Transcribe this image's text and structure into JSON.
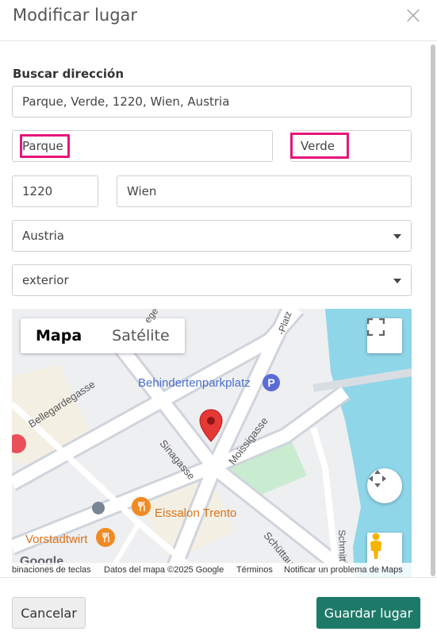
{
  "modal": {
    "title": "Modificar lugar",
    "close_symbol": "×",
    "close_icon": "close-icon"
  },
  "form": {
    "search_label": "Buscar dirección",
    "search_value": "Parque, Verde, 1220, Wien, Austria",
    "street_value": "Parque",
    "number_value": "Verde",
    "postal_value": "1220",
    "city_value": "Wien",
    "country_value": "Austria",
    "type_value": "exterior",
    "highlight_color": "#e6157a"
  },
  "map": {
    "type_map": "Mapa",
    "type_satellite": "Satélite",
    "labels": {
      "parking": "Behindertenparkplatz",
      "parking_badge": "P",
      "street_sinagasse": "Sinagasse",
      "street_moissigasse": "Moissigasse",
      "street_bellegarde": "Bellegardegasse",
      "street_schuttau": "Schüttau",
      "street_schmitt": "Schmitt",
      "street_platz": "-Platz",
      "street_top": "ege",
      "poi_eissalon": "Eissalon Trento",
      "poi_vorstadtwirt": "Vorstadtwirt",
      "google_logo": "Google"
    },
    "attribution": {
      "shortcuts": "binaciones de teclas",
      "data": "Datos del mapa ©2025 Google",
      "terms": "Términos",
      "report": "Notificar un problema de Maps"
    },
    "colors": {
      "water": "#8fd6e9",
      "park": "#c9ecd0",
      "road": "#ffffff",
      "marker": "#e53935",
      "parking_badge": "#5b6bd6",
      "poi": "#f08a24",
      "label": "#4a6ed0"
    },
    "icons": [
      "fullscreen-icon",
      "compass-icon",
      "pegman-icon",
      "map-marker-icon",
      "restaurant-icon"
    ]
  },
  "footer": {
    "cancel_label": "Cancelar",
    "save_label": "Guardar lugar",
    "save_color": "#1e7a68"
  }
}
